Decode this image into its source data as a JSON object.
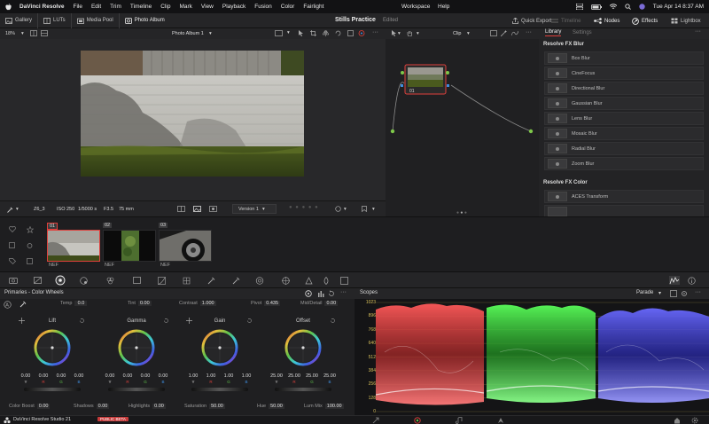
{
  "menubar": {
    "app_name": "DaVinci Resolve",
    "items": [
      "File",
      "Edit",
      "Trim",
      "Timeline",
      "Clip",
      "Mark",
      "View",
      "Playback",
      "Fusion",
      "Color",
      "Fairlight"
    ],
    "workspace": "Workspace",
    "help": "Help",
    "datetime": "Tue Apr 14  8:37 AM"
  },
  "toolbar": {
    "gallery": "Gallery",
    "luts": "LUTs",
    "media_pool": "Media Pool",
    "photo_album": "Photo Album",
    "project_title": "Stills Practice",
    "project_status": "Edited",
    "quick_export": "Quick Export",
    "timeline": "Timeline",
    "nodes": "Nodes",
    "effects": "Effects",
    "lightbox": "Lightbox"
  },
  "viewer": {
    "zoom": "18%",
    "album_select": "Photo Album 1",
    "clip_name": "Z6_3",
    "iso": "ISO 250",
    "shutter": "1/5000 s",
    "aperture": "F3.5",
    "focal": "75 mm",
    "version": "Version 1"
  },
  "nodes": {
    "mode": "Clip",
    "node_label": "01"
  },
  "library": {
    "tab_library": "Library",
    "tab_settings": "Settings",
    "section_blur": "Resolve FX Blur",
    "blur_items": [
      "Box Blur",
      "CineFocus",
      "Directional Blur",
      "Gaussian Blur",
      "Lens Blur",
      "Mosaic Blur",
      "Radial Blur",
      "Zoom Blur"
    ],
    "section_color": "Resolve FX Color",
    "color_items": [
      "ACES Transform"
    ]
  },
  "clips": [
    {
      "num": "01",
      "label": "NEF"
    },
    {
      "num": "02",
      "label": "NEF"
    },
    {
      "num": "03",
      "label": "NEF"
    }
  ],
  "color_wheels": {
    "title": "Primaries - Color Wheels",
    "temp_label": "Temp",
    "temp": "0.0",
    "tint_label": "Tint",
    "tint": "0.00",
    "contrast_label": "Contrast",
    "contrast": "1.000",
    "pivot_label": "Pivot",
    "pivot": "0.435",
    "middetail_label": "Mid/Detail",
    "middetail": "0.00",
    "wheels": [
      {
        "name": "Lift",
        "values": [
          "0.00",
          "0.00",
          "0.00",
          "0.00"
        ]
      },
      {
        "name": "Gamma",
        "values": [
          "0.00",
          "0.00",
          "0.00",
          "0.00"
        ]
      },
      {
        "name": "Gain",
        "values": [
          "1.00",
          "1.00",
          "1.00",
          "1.00"
        ]
      },
      {
        "name": "Offset",
        "values": [
          "25.00",
          "25.00",
          "25.00",
          "25.00"
        ]
      }
    ],
    "channel_labels": [
      "Y",
      "R",
      "G",
      "B"
    ],
    "colorboost_label": "Color Boost",
    "colorboost": "0.00",
    "shadows_label": "Shadows",
    "shadows": "0.00",
    "highlights_label": "Highlights",
    "highlights": "0.00",
    "saturation_label": "Saturation",
    "saturation": "50.00",
    "hue_label": "Hue",
    "hue": "50.00",
    "lummix_label": "Lum Mix",
    "lummix": "100.00"
  },
  "scopes": {
    "title": "Scopes",
    "mode": "Parade",
    "ticks": [
      "1023",
      "896",
      "768",
      "640",
      "512",
      "384",
      "256",
      "128",
      "0"
    ]
  },
  "bottom": {
    "product": "DaVinci Resolve Studio 21",
    "badge": "PUBLIC BETA"
  },
  "colors": {
    "accent_red": "#e0403c",
    "node_green": "#7ec84a",
    "selected_blue": "#3e8ee0"
  }
}
